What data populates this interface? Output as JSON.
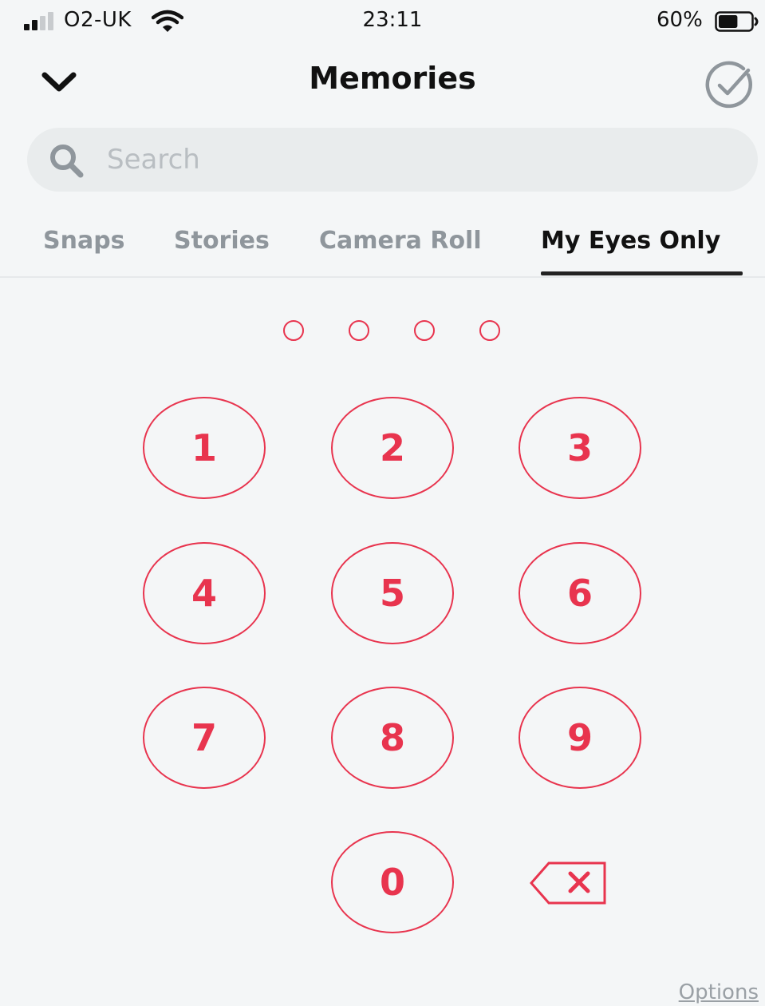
{
  "status_bar": {
    "carrier": "O2-UK",
    "time": "23:11",
    "battery_percent": "60%",
    "battery_level": 0.6,
    "signal_bars_filled": 2,
    "signal_bars_total": 4
  },
  "header": {
    "title": "Memories",
    "back_icon": "chevron-down-icon",
    "select_icon": "check-circle-icon"
  },
  "search": {
    "placeholder": "Search",
    "value": "",
    "icon": "search-icon"
  },
  "tabs": [
    {
      "label": "Snaps",
      "active": false
    },
    {
      "label": "Stories",
      "active": false
    },
    {
      "label": "Camera Roll",
      "active": false
    },
    {
      "label": "My Eyes Only",
      "active": true
    }
  ],
  "pin": {
    "length": 4,
    "entered": 0
  },
  "keypad": {
    "keys": [
      "1",
      "2",
      "3",
      "4",
      "5",
      "6",
      "7",
      "8",
      "9",
      "0"
    ],
    "backspace_icon": "backspace-icon"
  },
  "footer": {
    "options_label": "Options"
  },
  "colors": {
    "accent": "#e8344e",
    "background": "#f4f6f7",
    "text": "#111111",
    "tab_inactive": "#8f969c",
    "search_bg": "#e9eced"
  }
}
